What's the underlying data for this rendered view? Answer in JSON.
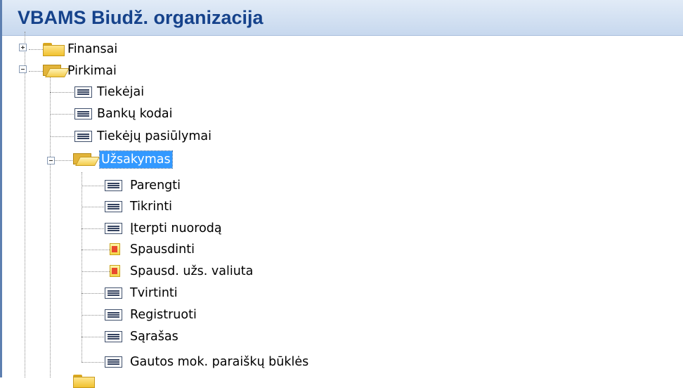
{
  "window": {
    "title": "VBAMS Biudž. organizacija"
  },
  "tree": {
    "finansai": {
      "label": "Finansai",
      "icon": "folder-closed-icon",
      "state": "collapsed"
    },
    "pirkimai": {
      "label": "Pirkimai",
      "icon": "folder-open-icon",
      "state": "expanded"
    },
    "pirkimai_children": [
      {
        "label": "Tiekėjai",
        "icon": "form-icon"
      },
      {
        "label": "Bankų kodai",
        "icon": "form-icon"
      },
      {
        "label": "Tiekėjų pasiūlymai",
        "icon": "form-icon"
      }
    ],
    "uzsakymas": {
      "label": "Užsakymas",
      "icon": "folder-open-icon",
      "state": "expanded",
      "selected": true
    },
    "uzsakymas_children": [
      {
        "label": "Parengti",
        "icon": "form-icon"
      },
      {
        "label": "Tikrinti",
        "icon": "form-icon"
      },
      {
        "label": "Įterpti nuorodą",
        "icon": "form-icon"
      },
      {
        "label": "Spausdinti",
        "icon": "report-icon"
      },
      {
        "label": "Spausd. užs. valiuta",
        "icon": "report-icon"
      },
      {
        "label": "Tvirtinti",
        "icon": "form-icon"
      },
      {
        "label": "Registruoti",
        "icon": "form-icon"
      },
      {
        "label": "Sąrašas",
        "icon": "form-icon"
      },
      {
        "label": "Gautos mok. paraiškų būklės",
        "icon": "form-icon"
      }
    ]
  }
}
